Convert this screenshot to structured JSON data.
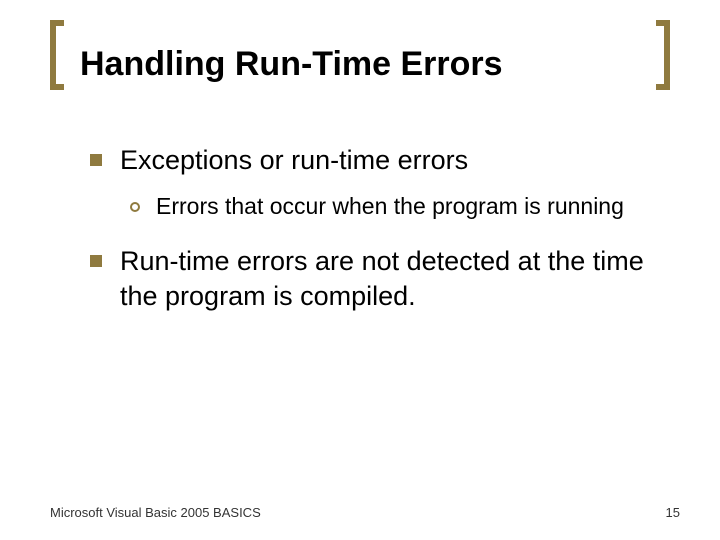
{
  "title": "Handling Run-Time Errors",
  "bullets": {
    "b1": {
      "text": "Exceptions or run-time errors",
      "sub": {
        "s1": "Errors that occur when the program is running"
      }
    },
    "b2": {
      "text": "Run-time errors are not detected at the time the program is compiled."
    }
  },
  "footer": {
    "left": "Microsoft Visual Basic 2005 BASICS",
    "right": "15"
  }
}
